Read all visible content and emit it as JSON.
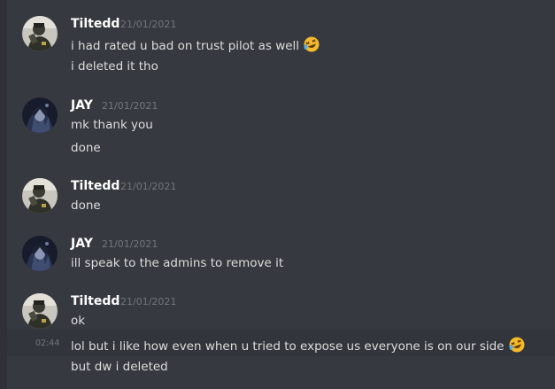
{
  "messages": [
    {
      "username": "Tiltedd",
      "timestamp": "21/01/2021",
      "avatar": "tiltedd-avatar",
      "lines": [
        "i had rated u bad on trust pilot as well",
        "i deleted it tho"
      ],
      "emoji": "rolling-on-floor-laughing"
    },
    {
      "username": "JAY",
      "timestamp": "21/01/2021",
      "avatar": "jay-avatar",
      "lines": [
        "mk thank you",
        "done"
      ]
    },
    {
      "username": "Tiltedd",
      "timestamp": "21/01/2021",
      "avatar": "tiltedd-avatar",
      "lines": [
        "done"
      ]
    },
    {
      "username": "JAY",
      "timestamp": "21/01/2021",
      "avatar": "jay-avatar",
      "lines": [
        "ill speak to the admins to remove it"
      ]
    },
    {
      "username": "Tiltedd",
      "timestamp": "21/01/2021",
      "avatar": "tiltedd-avatar",
      "lines": [
        "ok",
        "lol but i like how even when u tried to expose us everyone is on our side",
        "but dw i deleted"
      ],
      "hover_time": "02:44",
      "emoji": "rolling-on-floor-laughing"
    }
  ],
  "colors": {
    "background": "#36393f",
    "username": "#ffffff",
    "message_text": "#dcddde",
    "timestamp": "#72767d",
    "hover_row": "#32353b"
  }
}
